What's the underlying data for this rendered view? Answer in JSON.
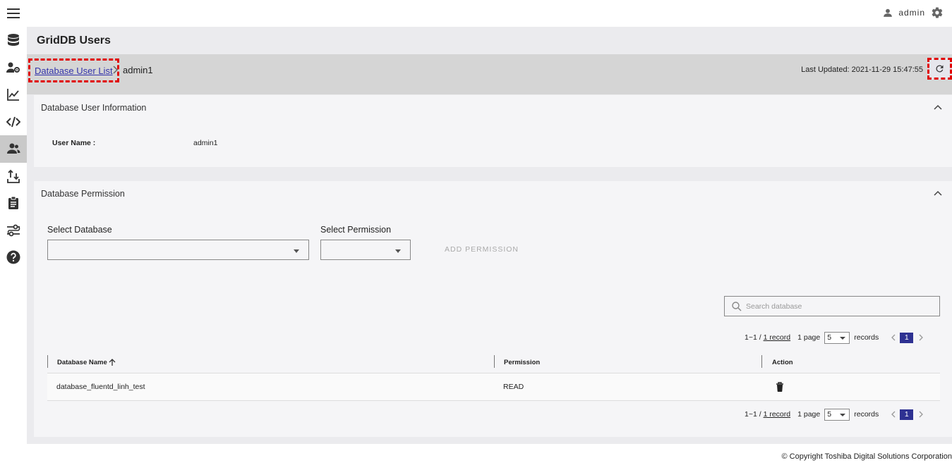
{
  "header": {
    "user_name": "admin"
  },
  "page": {
    "title": "GridDB Users"
  },
  "breadcrumb": {
    "link_label": "Database User List",
    "current": "admin1",
    "last_updated": "Last Updated: 2021-11-29 15:47:55"
  },
  "user_info": {
    "title": "Database User Information",
    "label": "User Name :",
    "value": "admin1"
  },
  "permission": {
    "title": "Database Permission",
    "select_db_label": "Select Database",
    "select_perm_label": "Select Permission",
    "add_button": "ADD PERMISSION",
    "search_placeholder": "Search database"
  },
  "pager": {
    "range": "1~1 / ",
    "records_link": "1 record",
    "pages": "1 page",
    "per_page": "5",
    "records_label": "records",
    "current_page": "1"
  },
  "table": {
    "columns": [
      "Database Name",
      "Permission",
      "Action"
    ],
    "rows": [
      {
        "database_name": "database_fluentd_linh_test",
        "permission": "READ"
      }
    ]
  },
  "footer": {
    "copyright": "© Copyright Toshiba Digital Solutions Corporation"
  },
  "icons": {
    "sidebar": [
      "database-icon",
      "user-settings-icon",
      "chart-line-icon",
      "code-icon",
      "users-icon",
      "import-export-icon",
      "clipboard-icon",
      "settings-flow-icon",
      "help-icon"
    ],
    "accent": "#2e3192",
    "highlight": "#e00000"
  }
}
